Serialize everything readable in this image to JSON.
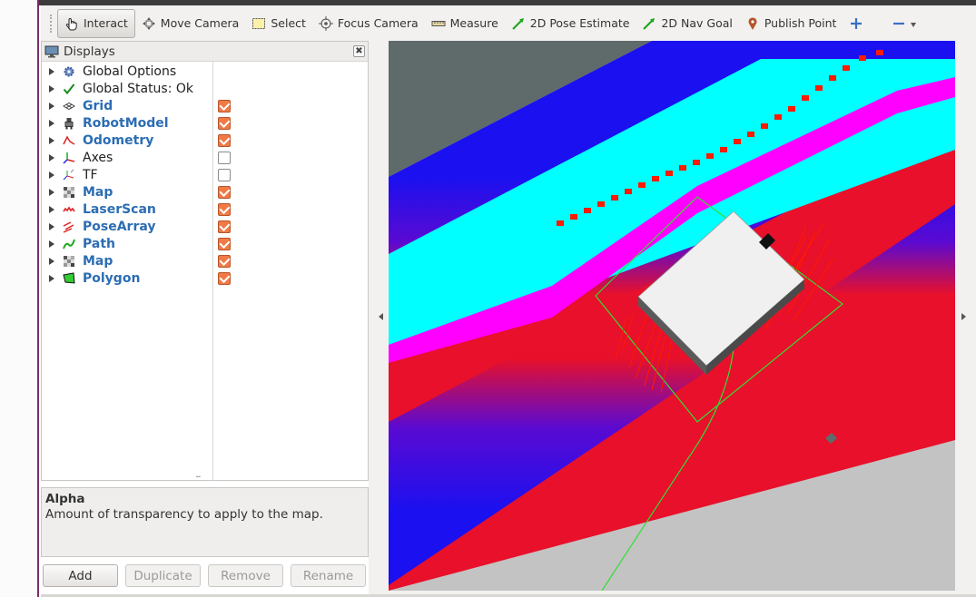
{
  "toolbar": {
    "interact": "Interact",
    "move_camera": "Move Camera",
    "select": "Select",
    "focus_camera": "Focus Camera",
    "measure": "Measure",
    "pose_estimate": "2D Pose Estimate",
    "nav_goal": "2D Nav Goal",
    "publish_point": "Publish Point"
  },
  "displays": {
    "title": "Displays",
    "items": [
      {
        "label": "Global Options",
        "icon": "gear-icon",
        "checkbox": null,
        "highlight": false
      },
      {
        "label": "Global Status: Ok",
        "icon": "checkmark-icon",
        "checkbox": null,
        "highlight": false
      },
      {
        "label": "Grid",
        "icon": "grid-icon",
        "checkbox": true,
        "highlight": true
      },
      {
        "label": "RobotModel",
        "icon": "robot-icon",
        "checkbox": true,
        "highlight": true
      },
      {
        "label": "Odometry",
        "icon": "odometry-icon",
        "checkbox": true,
        "highlight": true
      },
      {
        "label": "Axes",
        "icon": "axes-icon",
        "checkbox": false,
        "highlight": false
      },
      {
        "label": "TF",
        "icon": "tf-icon",
        "checkbox": false,
        "highlight": false
      },
      {
        "label": "Map",
        "icon": "map-icon",
        "checkbox": true,
        "highlight": true
      },
      {
        "label": "LaserScan",
        "icon": "laserscan-icon",
        "checkbox": true,
        "highlight": true
      },
      {
        "label": "PoseArray",
        "icon": "posearray-icon",
        "checkbox": true,
        "highlight": true
      },
      {
        "label": "Path",
        "icon": "path-icon",
        "checkbox": true,
        "highlight": true
      },
      {
        "label": "Map",
        "icon": "map-icon",
        "checkbox": true,
        "highlight": true
      },
      {
        "label": "Polygon",
        "icon": "polygon-icon",
        "checkbox": true,
        "highlight": true
      }
    ]
  },
  "description": {
    "title": "Alpha",
    "text": "Amount of transparency to apply to the map."
  },
  "buttons": {
    "add": "Add",
    "duplicate": "Duplicate",
    "remove": "Remove",
    "rename": "Rename"
  },
  "colors": {
    "costmap_blue": "#1a10f0",
    "costmap_red": "#e8102a",
    "inflation_cyan": "#00ffff",
    "obstacle_magenta": "#ff00ff",
    "laser_red": "#ff1a00",
    "footprint_green": "#33dd33",
    "unknown_gray": "#c3c3c3",
    "background_dark": "#5f6a6b"
  }
}
